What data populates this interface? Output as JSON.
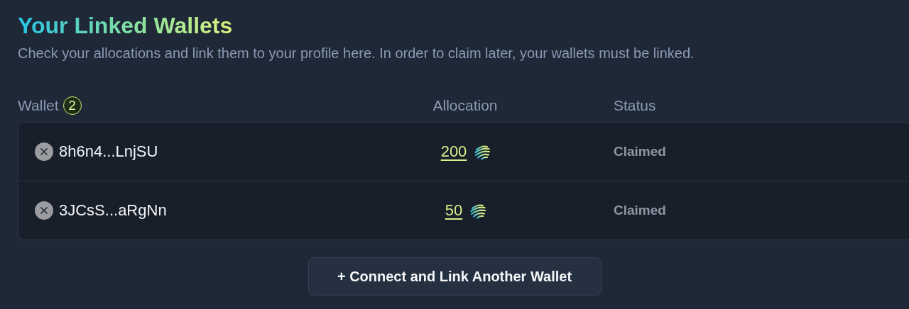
{
  "header": {
    "title": "Your Linked Wallets",
    "subtitle": "Check your allocations and link them to your profile here. In order to claim later, your wallets must be linked."
  },
  "table": {
    "columns": [
      {
        "label": "Wallet",
        "count": "2"
      },
      {
        "label": "Allocation"
      },
      {
        "label": "Status"
      }
    ],
    "rows": [
      {
        "wallet": "8h6n4...LnjSU",
        "allocation": "200",
        "status": "Claimed"
      },
      {
        "wallet": "3JCsS...aRgNn",
        "allocation": "50",
        "status": "Claimed"
      }
    ]
  },
  "connect_button": "+ Connect and Link Another Wallet"
}
